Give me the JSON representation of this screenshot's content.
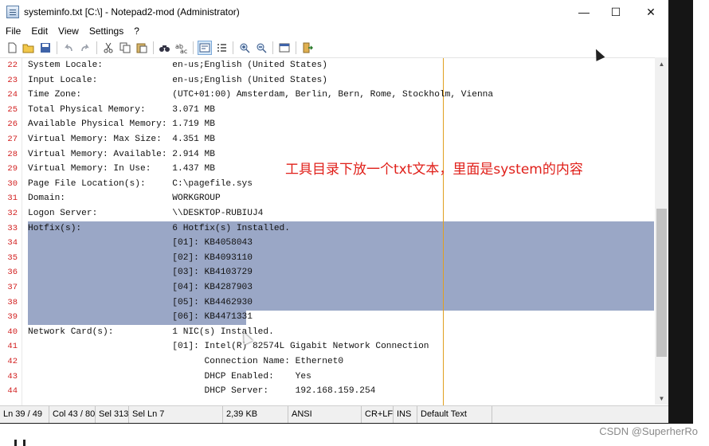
{
  "window": {
    "title": "systeminfo.txt [C:\\] - Notepad2-mod (Administrator)",
    "controls": {
      "minimize": "—",
      "maximize": "☐",
      "close": "✕"
    }
  },
  "menu": [
    "File",
    "Edit",
    "View",
    "Settings",
    "?"
  ],
  "toolbar": [
    "new-file-icon",
    "open-folder-icon",
    "save-icon",
    "undo-icon",
    "redo-icon",
    "cut-icon",
    "copy-icon",
    "paste-icon",
    "find-icon",
    "replace-icon",
    "word-wrap-icon",
    "list-icon",
    "zoom-in-icon",
    "zoom-out-icon",
    "settings-icon",
    "exit-icon"
  ],
  "editor": {
    "lines": [
      {
        "n": "22",
        "t": "System Locale:             en-us;English (United States)"
      },
      {
        "n": "23",
        "t": "Input Locale:              en-us;English (United States)"
      },
      {
        "n": "24",
        "t": "Time Zone:                 (UTC+01:00) Amsterdam, Berlin, Bern, Rome, Stockholm, Vienna"
      },
      {
        "n": "25",
        "t": "Total Physical Memory:     3.071 MB"
      },
      {
        "n": "26",
        "t": "Available Physical Memory: 1.719 MB"
      },
      {
        "n": "27",
        "t": "Virtual Memory: Max Size:  4.351 MB"
      },
      {
        "n": "28",
        "t": "Virtual Memory: Available: 2.914 MB"
      },
      {
        "n": "29",
        "t": "Virtual Memory: In Use:    1.437 MB"
      },
      {
        "n": "30",
        "t": "Page File Location(s):     C:\\pagefile.sys"
      },
      {
        "n": "31",
        "t": "Domain:                    WORKGROUP"
      },
      {
        "n": "32",
        "t": "Logon Server:              \\\\DESKTOP-RUBIUJ4"
      },
      {
        "n": "33",
        "t": "Hotfix(s):                 6 Hotfix(s) Installed."
      },
      {
        "n": "34",
        "t": "                           [01]: KB4058043"
      },
      {
        "n": "35",
        "t": "                           [02]: KB4093110"
      },
      {
        "n": "36",
        "t": "                           [03]: KB4103729"
      },
      {
        "n": "37",
        "t": "                           [04]: KB4287903"
      },
      {
        "n": "38",
        "t": "                           [05]: KB4462930"
      },
      {
        "n": "39",
        "t": "                           [06]: KB4471331"
      },
      {
        "n": "40",
        "t": "Network Card(s):           1 NIC(s) Installed."
      },
      {
        "n": "41",
        "t": "                           [01]: Intel(R) 82574L Gigabit Network Connection"
      },
      {
        "n": "42",
        "t": "                                 Connection Name: Ethernet0"
      },
      {
        "n": "43",
        "t": "                                 DHCP Enabled:    Yes"
      },
      {
        "n": "44",
        "t": "                                 DHCP Server:     192.168.159.254"
      }
    ],
    "selected_lines": [
      "33",
      "39"
    ],
    "long_line_marker_color": "#e0a020",
    "selection_color": "#9aa7c6",
    "line_number_color": "#d22020"
  },
  "annotation": "工具目录下放一个txt文本，里面是system的内容",
  "status": {
    "position": "Ln 39 / 49",
    "column": "Col 43 / 80",
    "selection": "Sel 313",
    "sel_lines": "Sel Ln 7",
    "size": "2,39 KB",
    "encoding": "ANSI",
    "eol": "CR+LF",
    "mode": "INS",
    "scheme": "Default Text"
  },
  "watermark": "CSDN @SuperherRo"
}
